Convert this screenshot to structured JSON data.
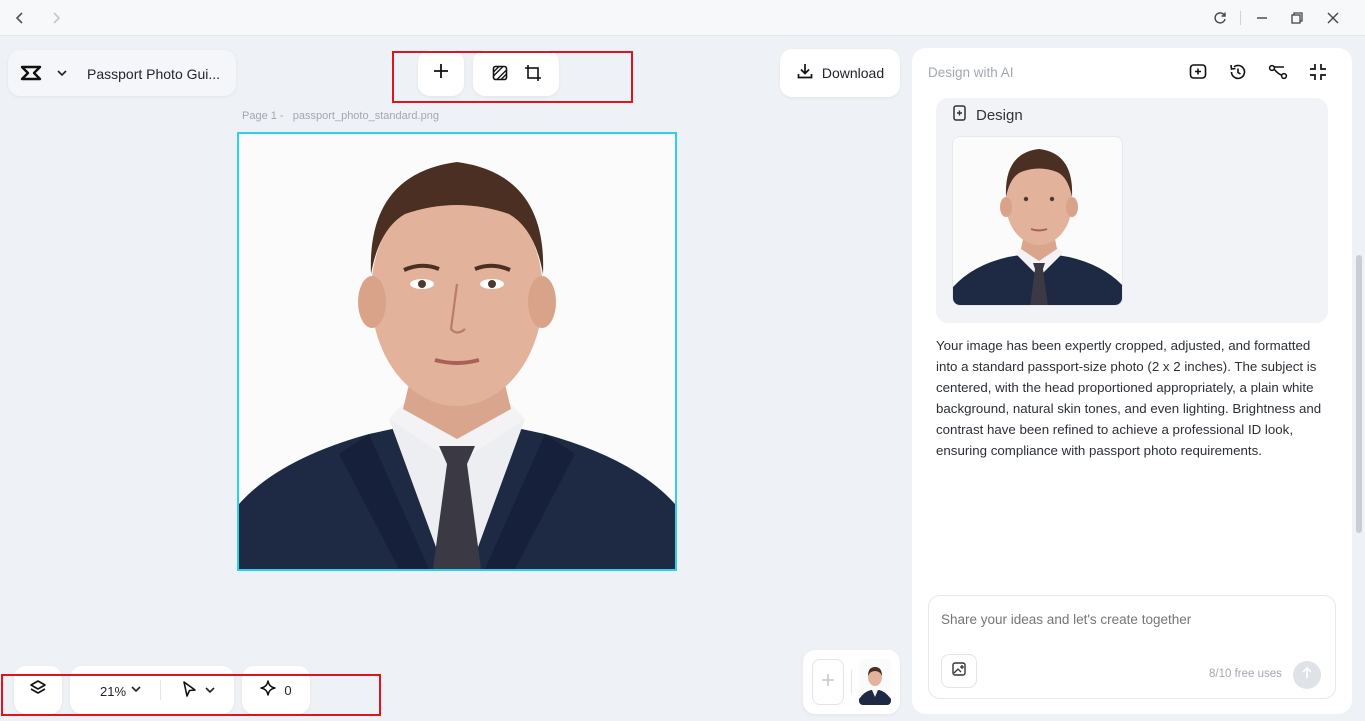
{
  "app": {
    "project_title": "Passport Photo Gui...",
    "download_label": "Download"
  },
  "canvas": {
    "page_prefix": "Page 1 -",
    "file_name": "passport_photo_standard.png"
  },
  "bottom_toolbar": {
    "zoom": "21%",
    "credits": "0"
  },
  "panel": {
    "title": "Design with AI",
    "design_label": "Design",
    "description": "Your image has been expertly cropped, adjusted, and formatted into a standard passport-size photo (2 x 2 inches). The subject is centered, with the head proportioned appropriately, a plain white background, natural skin tones, and even lighting. Brightness and contrast have been refined to achieve a professional ID look, ensuring compliance with passport photo requirements.",
    "chat_placeholder": "Share your ideas and let's create together",
    "free_uses": "8/10 free uses"
  },
  "colors": {
    "highlight": "#e0141e",
    "selection": "#2fd0e6",
    "suit": "#1e2a44"
  }
}
